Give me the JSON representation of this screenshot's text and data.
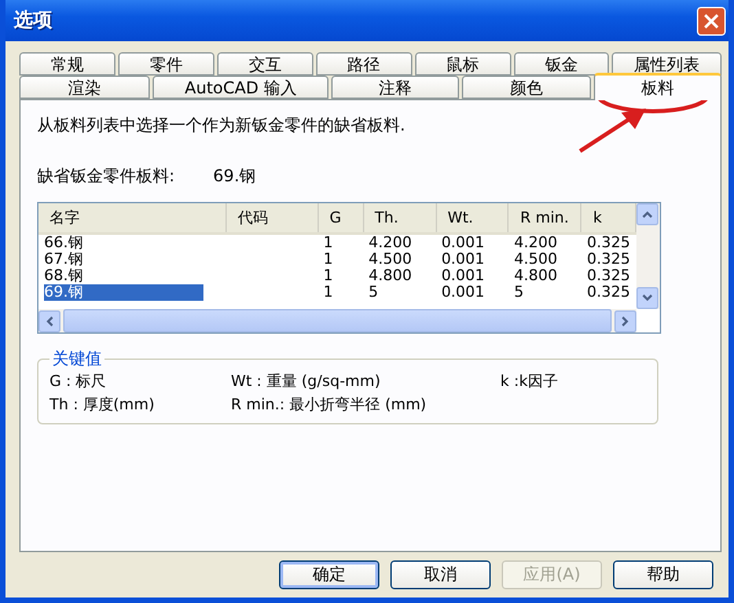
{
  "window": {
    "title": "选项"
  },
  "tab_rows": [
    [
      {
        "label": "常规",
        "selected": false
      },
      {
        "label": "零件",
        "selected": false
      },
      {
        "label": "交互",
        "selected": false
      },
      {
        "label": "路径",
        "selected": false
      },
      {
        "label": "鼠标",
        "selected": false
      },
      {
        "label": "钣金",
        "selected": false
      },
      {
        "label": "属性列表",
        "selected": false
      }
    ],
    [
      {
        "label": "渲染",
        "selected": false
      },
      {
        "label": "AutoCAD 输入",
        "selected": false
      },
      {
        "label": "注释",
        "selected": false
      },
      {
        "label": "颜色",
        "selected": false
      },
      {
        "label": "板料",
        "selected": true
      }
    ]
  ],
  "description": "从板料列表中选择一个作为新钣金零件的缺省板料.",
  "default_label": "缺省钣金零件板料:",
  "default_value": "69.钢",
  "table": {
    "columns": [
      "名字",
      "代码",
      "G",
      "Th.",
      "Wt.",
      "R min.",
      "k"
    ],
    "rows": [
      {
        "cells": [
          "66.钢",
          "",
          "1",
          "4.200",
          "0.001",
          "4.200",
          "0.325"
        ],
        "selected": false
      },
      {
        "cells": [
          "67.钢",
          "",
          "1",
          "4.500",
          "0.001",
          "4.500",
          "0.325"
        ],
        "selected": false
      },
      {
        "cells": [
          "68.钢",
          "",
          "1",
          "4.800",
          "0.001",
          "4.800",
          "0.325"
        ],
        "selected": false
      },
      {
        "cells": [
          "69.钢",
          "",
          "1",
          "5",
          "0.001",
          "5",
          "0.325"
        ],
        "selected": true
      }
    ]
  },
  "key_values": {
    "title": "关键值",
    "items": [
      "G : 标尺",
      "Wt : 重量 (g/sq-mm)",
      "k :k因子",
      "Th : 厚度(mm)",
      "R min.: 最小折弯半径 (mm)"
    ]
  },
  "buttons": [
    {
      "label": "确定",
      "disabled": false,
      "default": true
    },
    {
      "label": "取消",
      "disabled": false,
      "default": false
    },
    {
      "label": "应用(A)",
      "disabled": true,
      "default": false
    },
    {
      "label": "帮助",
      "disabled": false,
      "default": false
    }
  ]
}
